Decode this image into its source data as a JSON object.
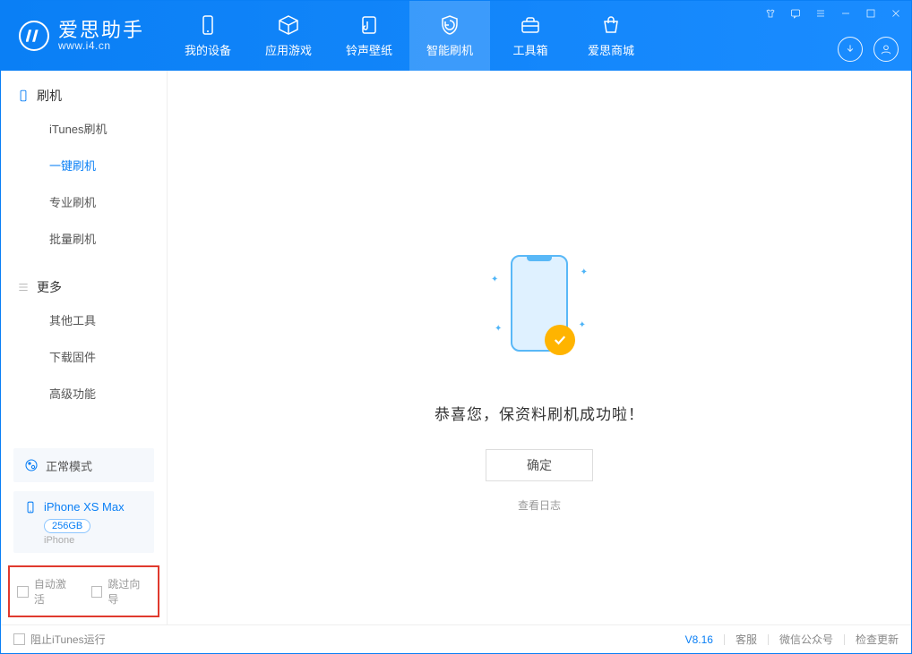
{
  "app": {
    "title": "爱思助手",
    "subtitle": "www.i4.cn"
  },
  "nav": [
    {
      "label": "我的设备"
    },
    {
      "label": "应用游戏"
    },
    {
      "label": "铃声壁纸"
    },
    {
      "label": "智能刷机",
      "active": true
    },
    {
      "label": "工具箱"
    },
    {
      "label": "爱思商城"
    }
  ],
  "sidebar": {
    "group1": "刷机",
    "items1": [
      "iTunes刷机",
      "一键刷机",
      "专业刷机",
      "批量刷机"
    ],
    "active_item": "一键刷机",
    "group2": "更多",
    "items2": [
      "其他工具",
      "下载固件",
      "高级功能"
    ],
    "mode": "正常模式",
    "device": {
      "name": "iPhone XS Max",
      "storage": "256GB",
      "type": "iPhone"
    },
    "chk1": "自动激活",
    "chk2": "跳过向导"
  },
  "main": {
    "success": "恭喜您，保资料刷机成功啦！",
    "ok": "确定",
    "log": "查看日志"
  },
  "statusbar": {
    "block_itunes": "阻止iTunes运行",
    "version": "V8.16",
    "links": [
      "客服",
      "微信公众号",
      "检查更新"
    ]
  }
}
